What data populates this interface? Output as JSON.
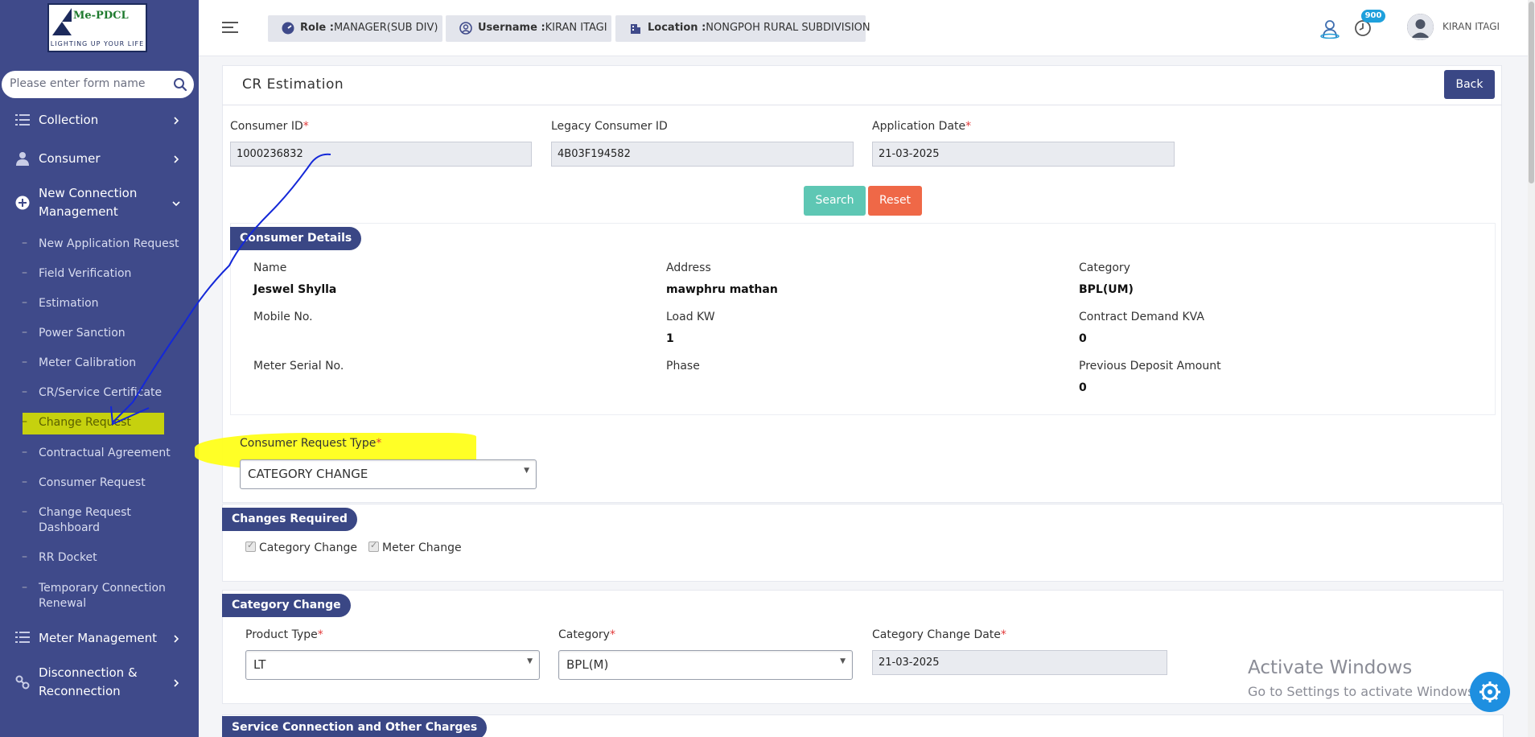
{
  "brand": {
    "logo_text": "Me-PDCL",
    "tagline": "LIGHTING UP YOUR LIFE"
  },
  "sidebar": {
    "search_placeholder": "Please enter form name",
    "menu": [
      {
        "label": "Collection",
        "icon": "list-icon"
      },
      {
        "label": "Consumer",
        "icon": "user-icon"
      },
      {
        "label": "New Connection Management",
        "label_line1": "New Connection",
        "label_line2": "Management",
        "icon": "plus-circle-icon",
        "expanded": true
      },
      {
        "label": "Meter Management",
        "icon": "list-icon"
      },
      {
        "label": "Disconnection & Reconnection",
        "label_line1": "Disconnection &",
        "label_line2": "Reconnection",
        "icon": "link-icon"
      }
    ],
    "submenu": [
      {
        "label": "New Application Request"
      },
      {
        "label": "Field Verification"
      },
      {
        "label": "Estimation"
      },
      {
        "label": "Power Sanction"
      },
      {
        "label": "Meter Calibration"
      },
      {
        "label": "CR/Service Certificate"
      },
      {
        "label": "Change Request",
        "active": true
      },
      {
        "label": "Contractual Agreement"
      },
      {
        "label": "Consumer Request"
      },
      {
        "label": "Change Request Dashboard",
        "label_line1": "Change Request",
        "label_line2": "Dashboard"
      },
      {
        "label": "RR Docket"
      },
      {
        "label": "Temporary Connection Renewal",
        "label_line1": "Temporary Connection",
        "label_line2": "Renewal"
      }
    ]
  },
  "topbar": {
    "role_key": "Role :",
    "role_value": "MANAGER(SUB DIV)",
    "username_key": "Username :",
    "username_value": "KIRAN ITAGI",
    "location_key": "Location :",
    "location_value": "NONGPOH RURAL SUBDIVISION",
    "notification_count": "900",
    "user_name": "KIRAN ITAGI"
  },
  "page": {
    "title": "CR Estimation",
    "back_label": "Back",
    "fields": {
      "consumer_id_label": "Consumer ID",
      "consumer_id_value": "1000236832",
      "legacy_id_label": "Legacy Consumer ID",
      "legacy_id_value": "4B03F194582",
      "app_date_label": "Application Date",
      "app_date_value": "21-03-2025"
    },
    "search_label": "Search",
    "reset_label": "Reset"
  },
  "consumer_details": {
    "section_title": "Consumer Details",
    "name_label": "Name",
    "name_value": "Jeswel Shylla",
    "address_label": "Address",
    "address_value": "mawphru mathan",
    "category_label": "Category",
    "category_value": "BPL(UM)",
    "mobile_label": "Mobile No.",
    "mobile_value": "",
    "load_label": "Load KW",
    "load_value": "1",
    "contract_label": "Contract Demand KVA",
    "contract_value": "0",
    "meter_label": "Meter Serial No.",
    "meter_value": "",
    "phase_label": "Phase",
    "phase_value": "",
    "deposit_label": "Previous Deposit Amount",
    "deposit_value": "0"
  },
  "request": {
    "type_label": "Consumer Request Type",
    "type_value": "CATEGORY CHANGE"
  },
  "changes_required": {
    "section_title": "Changes Required",
    "options": [
      {
        "label": "Category Change",
        "checked": true
      },
      {
        "label": "Meter Change",
        "checked": true
      }
    ]
  },
  "category_change": {
    "section_title": "Category Change",
    "product_type_label": "Product Type",
    "product_type_value": "LT",
    "category_label": "Category",
    "category_value": "BPL(M)",
    "change_date_label": "Category Change Date",
    "change_date_value": "21-03-2025"
  },
  "service_section": {
    "section_title": "Service Connection and Other Charges"
  },
  "watermark": {
    "line1": "Activate Windows",
    "line2": "Go to Settings to activate Windows."
  },
  "colors": {
    "sidebar": "#3f4a8a",
    "accent": "#3a4785",
    "search_btn": "#5ec7b4",
    "reset_btn": "#ef6847",
    "highlight": "#ffff1a"
  }
}
